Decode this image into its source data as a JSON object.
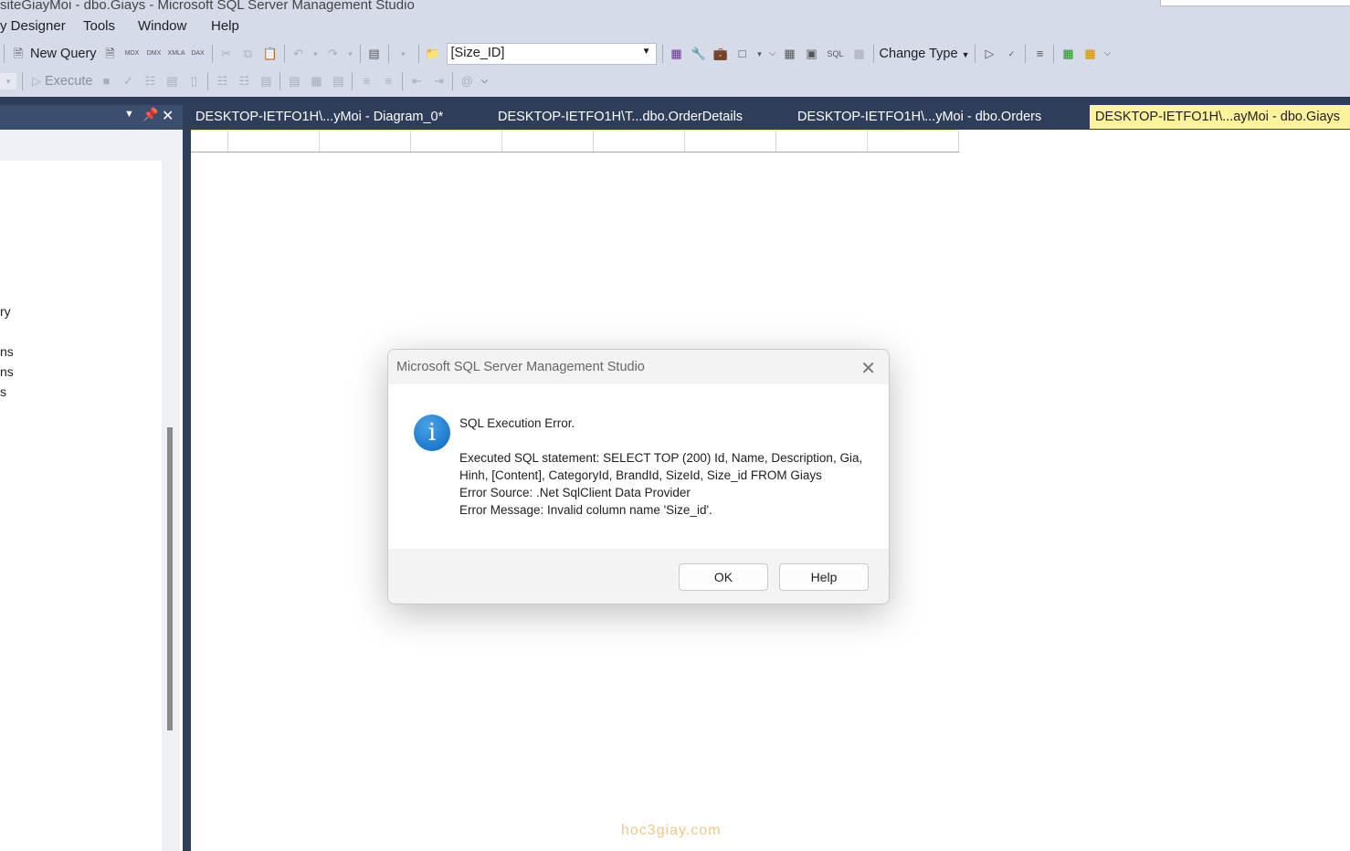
{
  "window": {
    "title": "siteGiayMoi - dbo.Giays - Microsoft SQL Server Management Studio"
  },
  "menu": [
    "y Designer",
    "Tools",
    "Window",
    "Help"
  ],
  "toolbar1": {
    "new_query": "New Query",
    "mdx": "MDX",
    "dmx": "DMX",
    "xmla": "XMLA",
    "dax": "DAX",
    "object_combo": "[Size_ID]",
    "sql_label": "SQL",
    "change_type": "Change Type"
  },
  "toolbar2": {
    "execute": "Execute"
  },
  "left_panel": {
    "items": [
      "ry",
      "ns",
      "ns",
      "s"
    ]
  },
  "tabs": [
    {
      "label": "DESKTOP-IETFO1H\\...yMoi - Diagram_0*"
    },
    {
      "label": "DESKTOP-IETFO1H\\T...dbo.OrderDetails"
    },
    {
      "label": "DESKTOP-IETFO1H\\...yMoi - dbo.Orders"
    },
    {
      "label": "DESKTOP-IETFO1H\\...ayMoi - dbo.Giays",
      "active": true
    }
  ],
  "dialog": {
    "title": "Microsoft SQL Server Management Studio",
    "heading": "SQL Execution Error.",
    "line1": "Executed SQL statement: SELECT TOP (200) Id, Name, Description, Gia,",
    "line2": "Hinh, [Content], CategoryId, BrandId, SizeId, Size_id FROM Giays",
    "line3": "Error Source: .Net SqlClient Data Provider",
    "line4": "Error Message: Invalid column name 'Size_id'.",
    "ok": "OK",
    "help": "Help",
    "icon": "info-icon"
  },
  "watermark": "hoc3giay.com",
  "colors": {
    "chrome": "#d6dbe9",
    "dark": "#2e3d5a",
    "active_tab": "#fff29d"
  }
}
